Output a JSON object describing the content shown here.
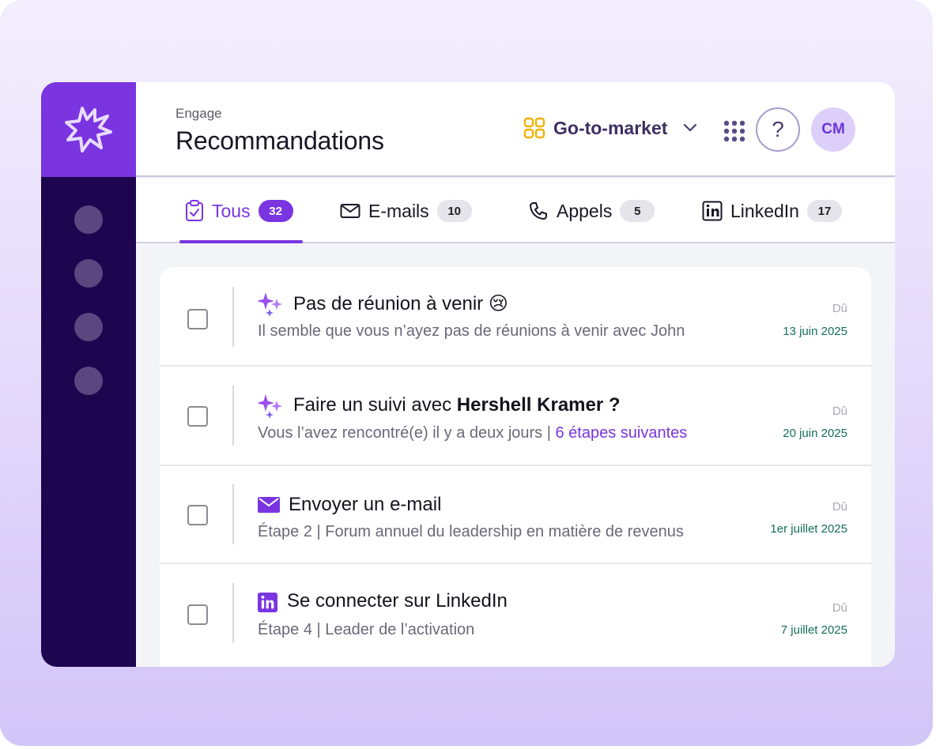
{
  "header": {
    "breadcrumb": "Engage",
    "title": "Recommandations",
    "workspace": "Go-to-market",
    "help": "?",
    "avatar_initials": "CM"
  },
  "tabs": [
    {
      "label": "Tous",
      "count": "32",
      "icon": "clipboard-check-icon",
      "active": true
    },
    {
      "label": "E-mails",
      "count": "10",
      "icon": "envelope-icon"
    },
    {
      "label": "Appels",
      "count": "5",
      "icon": "phone-icon"
    },
    {
      "label": "LinkedIn",
      "count": "17",
      "icon": "linkedin-icon"
    }
  ],
  "items": [
    {
      "icon": "sparkles-icon",
      "title": "Pas de réunion à venir 😢",
      "subtitle": "Il semble que vous n’ayez pas de réunions à venir avec John",
      "due_label": "Dû",
      "due_date": "13 juin 2025"
    },
    {
      "icon": "sparkles-icon",
      "title_prefix": "Faire un suivi avec ",
      "title_bold": "Hershell Kramer ?",
      "subtitle": "Vous l’avez rencontré(e) il y a deux jours | ",
      "subtitle_link": "6 étapes suivantes",
      "due_label": "Dû",
      "due_date": "20 juin 2025"
    },
    {
      "icon": "envelope-icon",
      "title": "Envoyer un e-mail",
      "subtitle": "Étape 2 | Forum annuel du leadership en matière de revenus",
      "due_label": "Dû",
      "due_date": "1er juillet 2025"
    },
    {
      "icon": "linkedin-icon",
      "title": "Se connecter sur LinkedIn",
      "subtitle": "Étape 4 | Leader de l’activation",
      "due_label": "Dû",
      "due_date": "7 juillet 2025"
    }
  ],
  "colors": {
    "accent": "#7a34e0",
    "sidebar": "#1d0550",
    "date": "#136e57"
  }
}
